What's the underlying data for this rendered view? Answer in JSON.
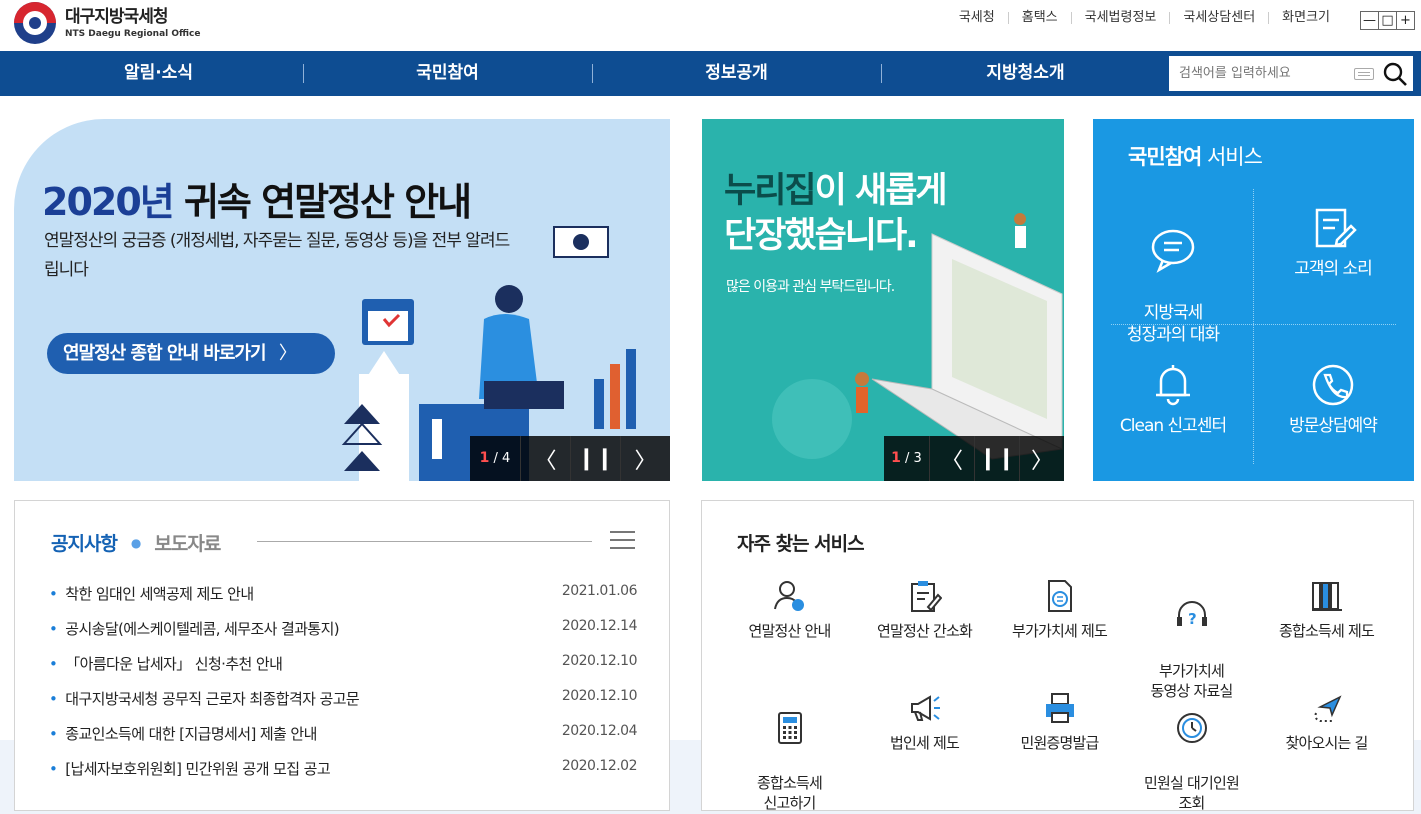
{
  "header": {
    "logo_ko": "대구지방국세청",
    "logo_en": "NTS Daegu Regional Office",
    "util_links": [
      "국세청",
      "홈택스",
      "국세법령정보",
      "국세상담센터",
      "화면크기"
    ],
    "zoom": {
      "minus": "—",
      "reset": "□",
      "plus": "+"
    }
  },
  "nav": {
    "items": [
      "알림·소식",
      "국민참여",
      "정보공개",
      "지방청소개"
    ],
    "search_placeholder": "검색어를 입력하세요"
  },
  "banner_main": {
    "title_year": "2020년",
    "title_rest": " 귀속 연말정산 안내",
    "desc": "연말정산의 궁금증 (개정세법, 자주묻는 질문, 동영상 등)을 전부 알려드립니다",
    "button": "연말정산 종합 안내 바로가기",
    "counter_current": "1",
    "counter_total": "/ 4"
  },
  "banner_second": {
    "title_hl": "누리집",
    "title_rest1": "이 새롭게",
    "title_line2": "단장했습니다.",
    "desc": "많은 이용과 관심 부탁드립니다.",
    "counter_current": "1",
    "counter_total": "/ 3"
  },
  "participation": {
    "title_bold": "국민참여",
    "title_rest": " 서비스",
    "items": [
      {
        "label": "지방국세\n청장과의 대화",
        "icon": "speech-bubble-icon"
      },
      {
        "label": "고객의 소리",
        "icon": "memo-pen-icon"
      },
      {
        "label": "Clean 신고센터",
        "icon": "bell-icon"
      },
      {
        "label": "방문상담예약",
        "icon": "phone-icon"
      }
    ]
  },
  "notice": {
    "tab_active": "공지사항",
    "tab_inactive": "보도자료",
    "rows": [
      {
        "title": "착한 임대인 세액공제 제도 안내",
        "date": "2021.01.06"
      },
      {
        "title": "공시송달(에스케이텔레콤, 세무조사 결과통지)",
        "date": "2020.12.14"
      },
      {
        "title": "「아름다운 납세자」 신청·추천 안내",
        "date": "2020.12.10"
      },
      {
        "title": "대구지방국세청 공무직 근로자 최종합격자 공고문",
        "date": "2020.12.10"
      },
      {
        "title": "종교인소득에 대한 [지급명세서] 제출 안내",
        "date": "2020.12.04"
      },
      {
        "title": "[납세자보호위원회] 민간위원 공개 모집 공고",
        "date": "2020.12.02"
      }
    ]
  },
  "frequent": {
    "title": "자주 찾는 서비스",
    "items": [
      {
        "label": "연말정산 안내",
        "icon": "person-heart-icon"
      },
      {
        "label": "연말정산 간소화",
        "icon": "clipboard-pen-icon"
      },
      {
        "label": "부가가치세 제도",
        "icon": "document-coin-icon"
      },
      {
        "label": "부가가치세\n동영상 자료실",
        "icon": "help-headset-icon"
      },
      {
        "label": "종합소득세 제도",
        "icon": "binders-icon"
      },
      {
        "label": "종합소득세\n신고하기",
        "icon": "calculator-icon"
      },
      {
        "label": "법인세 제도",
        "icon": "megaphone-icon"
      },
      {
        "label": "민원증명발급",
        "icon": "printer-icon"
      },
      {
        "label": "민원실 대기인원\n조회",
        "icon": "clock-icon"
      },
      {
        "label": "찾아오시는 길",
        "icon": "location-arrow-icon"
      }
    ]
  },
  "colors": {
    "nav_bg": "#0e4d92",
    "banner_main_bg": "#c4dff5",
    "banner_second_bg": "#2ab3ac",
    "participation_bg": "#1a98e3",
    "accent": "#1462b4"
  }
}
